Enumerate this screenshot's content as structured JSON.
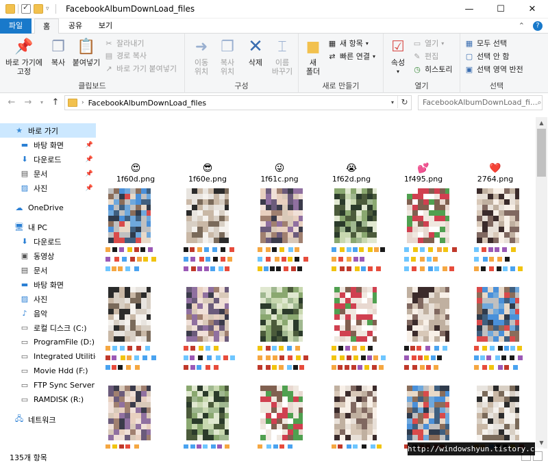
{
  "window": {
    "title": "FacebookAlbumDownLoad_files",
    "min_glyph": "—",
    "max_glyph": "☐",
    "close_glyph": "✕"
  },
  "ribbon_tabs": {
    "file": "파일",
    "home": "홈",
    "share": "공유",
    "view": "보기"
  },
  "ribbon": {
    "clipboard": {
      "label": "클립보드",
      "pin": "바로 가기에\n고정",
      "copy": "복사",
      "paste": "붙여넣기",
      "cut": "잘라내기",
      "copy_path": "경로 복사",
      "paste_shortcut": "바로 가기 붙여넣기"
    },
    "organize": {
      "label": "구성",
      "move_to": "이동\n위치",
      "copy_to": "복사\n위치",
      "delete": "삭제",
      "rename": "이름\n바꾸기"
    },
    "new": {
      "label": "새로 만들기",
      "new_folder": "새\n폴더",
      "new_item": "새 항목",
      "easy_access": "빠른 연결"
    },
    "open": {
      "label": "열기",
      "properties": "속성",
      "open": "열기",
      "edit": "편집",
      "history": "히스토리"
    },
    "select": {
      "label": "선택",
      "select_all": "모두 선택",
      "select_none": "선택 안 함",
      "invert": "선택 영역 반전"
    }
  },
  "address": {
    "path": "FacebookAlbumDownLoad_files",
    "search_placeholder": "FacebookAlbumDownLoad_fi..."
  },
  "nav": {
    "quick_access": "바로 가기",
    "qa_items": [
      "바탕 화면",
      "다운로드",
      "문서",
      "사진"
    ],
    "onedrive": "OneDrive",
    "this_pc": "내 PC",
    "pc_items": [
      "다운로드",
      "동영상",
      "문서",
      "바탕 화면",
      "사진",
      "음악",
      "로컬 디스크 (C:)",
      "ProgramFile (D:)",
      "Integrated Utilities (",
      "Movie Hdd (F:)",
      "FTP Sync Server (G",
      "RAMDISK (R:)"
    ],
    "network": "네트워크"
  },
  "files": [
    {
      "name": "1f60d.png",
      "emoji": "😍"
    },
    {
      "name": "1f60e.png",
      "emoji": "😎"
    },
    {
      "name": "1f61c.png",
      "emoji": "😜"
    },
    {
      "name": "1f62d.png",
      "emoji": "😭"
    },
    {
      "name": "1f495.png",
      "emoji": "💕"
    },
    {
      "name": "2764.png",
      "emoji": "❤️"
    }
  ],
  "status": {
    "item_count": "135개 항목"
  },
  "watermark": "http://windowshyun.tistory.com",
  "colors": {
    "accent": "#1979ca",
    "selection": "#cce8ff",
    "ribbon_bg": "#f5f6f7"
  }
}
